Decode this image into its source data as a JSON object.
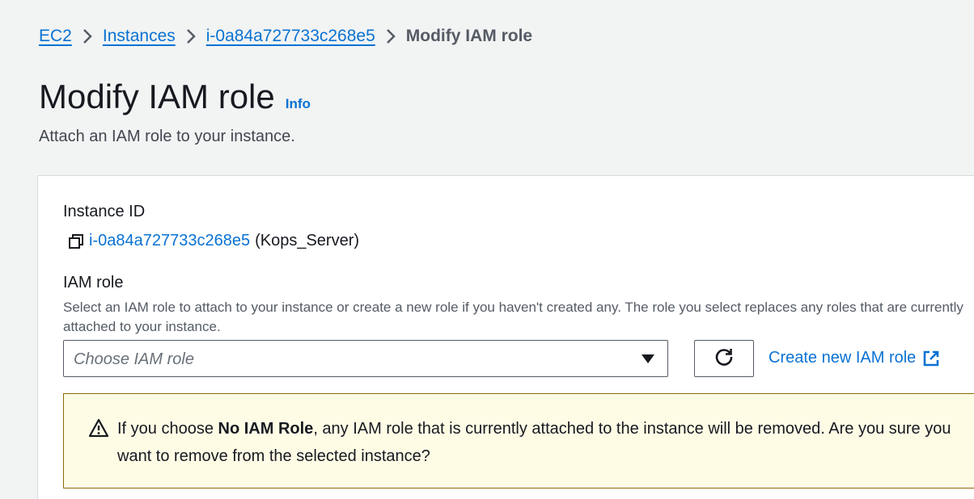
{
  "breadcrumb": {
    "items": [
      "EC2",
      "Instances",
      "i-0a84a727733c268e5"
    ],
    "current": "Modify IAM role"
  },
  "header": {
    "title": "Modify IAM role",
    "info_label": "Info",
    "subtitle": "Attach an IAM role to your instance."
  },
  "instance": {
    "label": "Instance ID",
    "id": "i-0a84a727733c268e5",
    "name": "(Kops_Server)"
  },
  "iam_role": {
    "label": "IAM role",
    "description": "Select an IAM role to attach to your instance or create a new role if you haven't created any. The role you select replaces any roles that are currently attached to your instance.",
    "placeholder": "Choose IAM role",
    "create_link": "Create new IAM role"
  },
  "alert": {
    "prefix": "If you choose ",
    "emphasis": "No IAM Role",
    "suffix": ", any IAM role that is currently attached to the instance will be removed. Are you sure you want to remove from the selected instance?"
  },
  "colors": {
    "link": "#0972d3",
    "background": "#f2f3f3",
    "warning_bg": "#fffce6",
    "warning_border": "#906806"
  },
  "icons": [
    "chevron-right-icon",
    "copy-icon",
    "caret-down-icon",
    "refresh-icon",
    "external-link-icon",
    "warning-icon"
  ]
}
